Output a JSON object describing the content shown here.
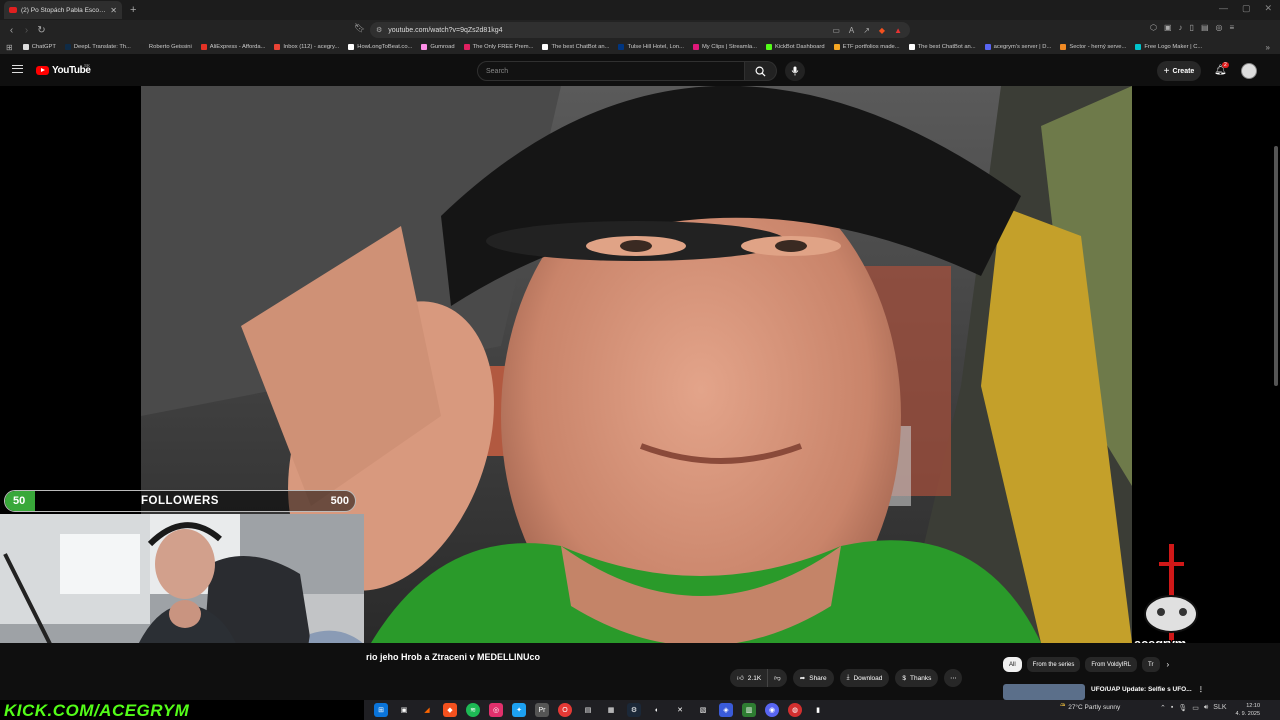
{
  "browser": {
    "tab_title": "(2) Po Stopách Pabla Escobar",
    "url": "youtube.com/watch?v=9qZs2d81kg4"
  },
  "bookmarks": [
    {
      "label": "ChatGPT",
      "color": "#dddddd"
    },
    {
      "label": "DeepL Translate: Th...",
      "color": "#0f2b46"
    },
    {
      "label": "Roberto Geissini",
      "color": "#222222"
    },
    {
      "label": "AliExpress - Afforda...",
      "color": "#e43225"
    },
    {
      "label": "Inbox (112) - acegry...",
      "color": "#ea4335"
    },
    {
      "label": "HowLongToBeat.co...",
      "color": "#ffffff"
    },
    {
      "label": "Gumroad",
      "color": "#ff90e8"
    },
    {
      "label": "The Only FREE Prem...",
      "color": "#e02060"
    },
    {
      "label": "The best ChatBot an...",
      "color": "#ffffff"
    },
    {
      "label": "Tulse Hill Hotel, Lon...",
      "color": "#003580"
    },
    {
      "label": "My Clips | Streamla...",
      "color": "#e0187a"
    },
    {
      "label": "KickBot Dashboard",
      "color": "#53fc18"
    },
    {
      "label": "ETF portfolios made...",
      "color": "#f5a623"
    },
    {
      "label": "The best ChatBot an...",
      "color": "#ffffff"
    },
    {
      "label": "acegrym's server | D...",
      "color": "#5865f2"
    },
    {
      "label": "Sector - herný serve...",
      "color": "#f08a24"
    },
    {
      "label": "Free Logo Maker | C...",
      "color": "#00c4cc"
    }
  ],
  "youtube": {
    "logo": "YouTube",
    "country": "SK",
    "search_placeholder": "Search",
    "create_label": "Create",
    "notifications": "2"
  },
  "overlay": {
    "followers_min": "50",
    "followers_label": "FOLLOWERS",
    "followers_max": "500",
    "followers_progress": 0.0,
    "kick": "KICK.COM/ACEGRYM",
    "brand": "acegrym"
  },
  "video": {
    "title": "rio jeho Hrob a Ztraceni v MEDELLINUco",
    "likes": "2.1K",
    "share": "Share",
    "download": "Download",
    "thanks": "Thanks"
  },
  "chips": [
    "All",
    "From the series",
    "From VoldyIRL",
    "Tr"
  ],
  "recommended": {
    "title": "UFO/UAP Update: Selfie s UFO..."
  },
  "taskbar": {
    "weather": "27°C  Partly sunny",
    "lang": "SLK",
    "time": "12:10",
    "date": "4. 9. 2025"
  }
}
